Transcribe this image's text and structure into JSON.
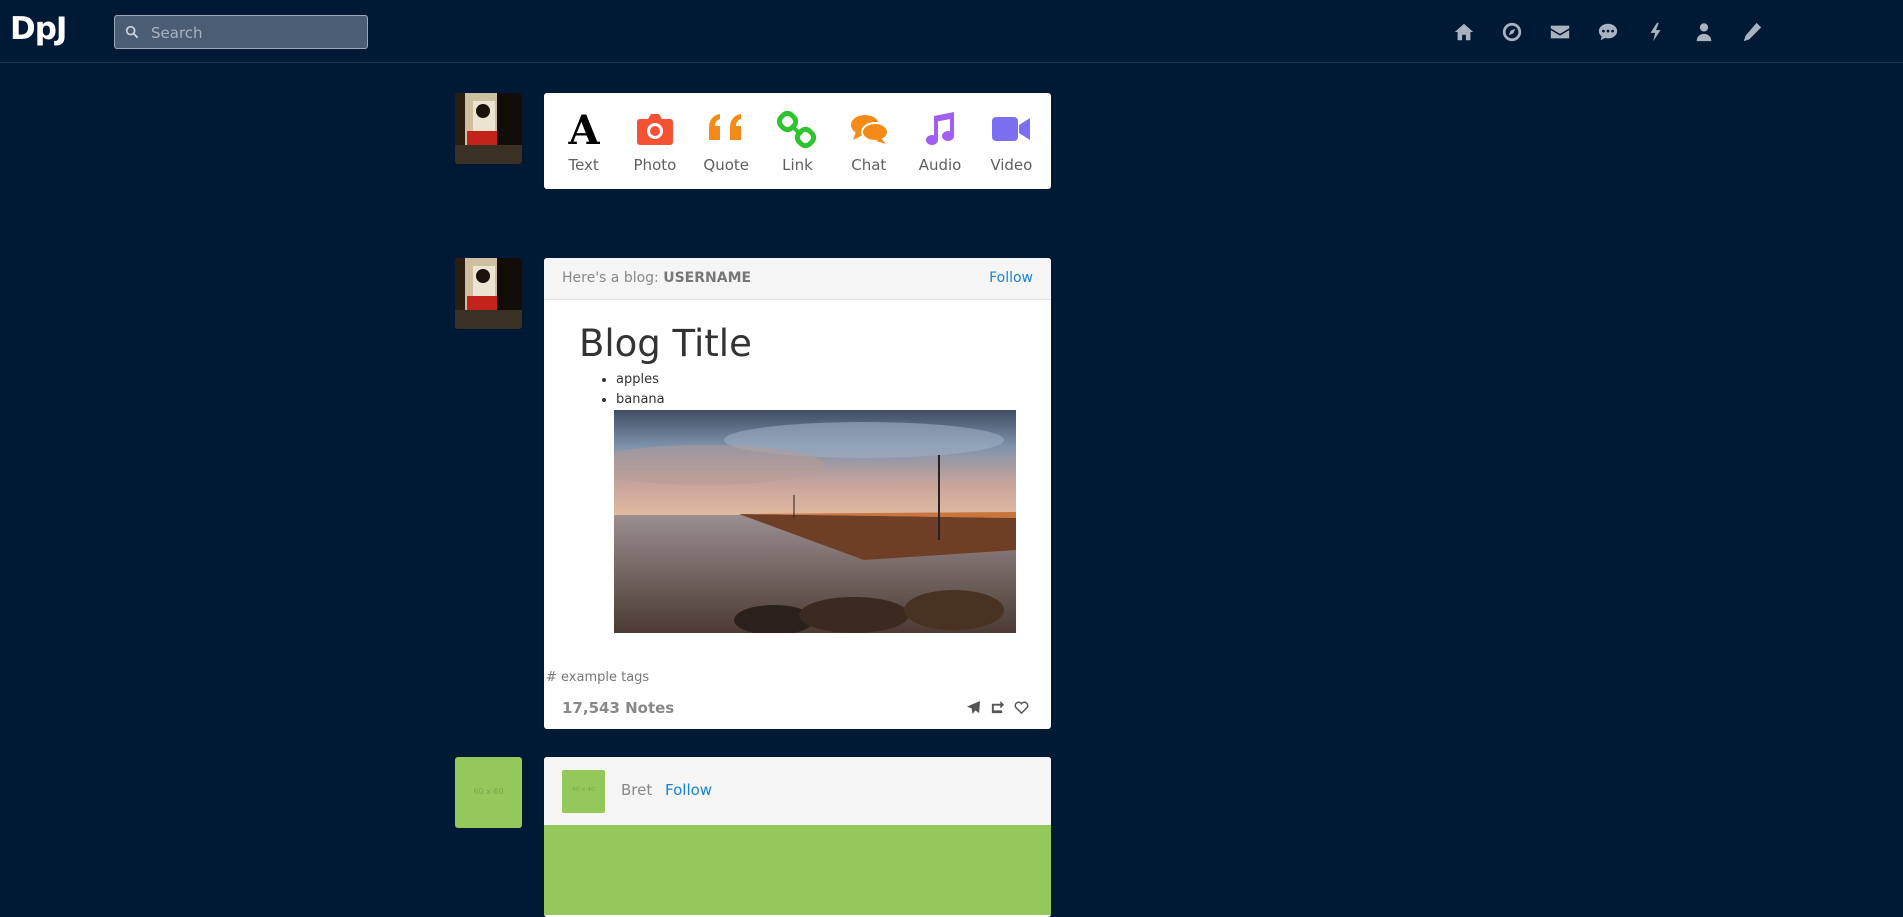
{
  "header": {
    "logo": "DpJ",
    "search_placeholder": "Search",
    "nav_icons": [
      "home-icon",
      "compass-icon",
      "mail-icon",
      "chat-bubble-icon",
      "lightning-icon",
      "user-icon",
      "pencil-icon"
    ]
  },
  "post_types": [
    {
      "label": "Text",
      "icon": "text-icon",
      "color": "#000000"
    },
    {
      "label": "Photo",
      "icon": "camera-icon",
      "color": "#f55233"
    },
    {
      "label": "Quote",
      "icon": "quote-icon",
      "color": "#f58b16"
    },
    {
      "label": "Link",
      "icon": "link-icon",
      "color": "#2ec42e"
    },
    {
      "label": "Chat",
      "icon": "chat-icon",
      "color": "#f58b16"
    },
    {
      "label": "Audio",
      "icon": "music-icon",
      "color": "#a15ef0"
    },
    {
      "label": "Video",
      "icon": "video-icon",
      "color": "#7b6ff0"
    }
  ],
  "post1": {
    "intro": "Here's a blog:",
    "username": "USERNAME",
    "follow": "Follow",
    "title": "Blog Title",
    "list": [
      "apples",
      "banana"
    ],
    "tags": "# example tags",
    "notes": "17,543 Notes"
  },
  "post2": {
    "avatar_text": "60 x 60",
    "mini_avatar_text": "40 x 40",
    "name": "Bret",
    "follow": "Follow"
  },
  "colors": {
    "background": "#001935",
    "accent_blue": "#1a82d6"
  }
}
